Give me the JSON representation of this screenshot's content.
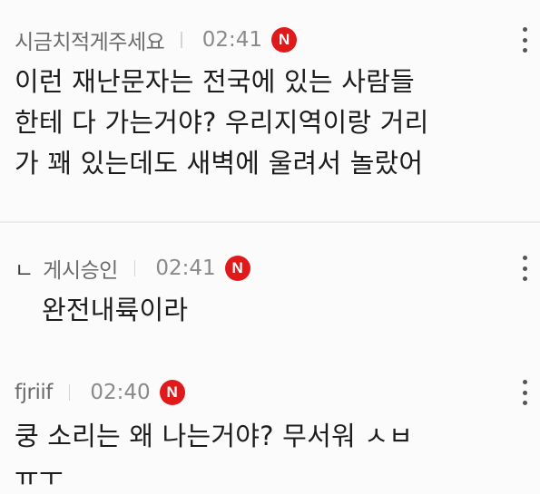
{
  "comments": [
    {
      "author": "시금치적게주세요",
      "time": "02:41",
      "badge": "N",
      "reply_marker": "",
      "body": "이런 재난문자는 전국에 있는 사람들\n한테 다 가는거야? 우리지역이랑 거리\n가 꽤 있는데도 새벽에 울려서 놀랐어"
    },
    {
      "author": "게시승인",
      "time": "02:41",
      "badge": "N",
      "reply_marker": "ㄴ",
      "body": "완전내륙이라"
    },
    {
      "author": "fjriif",
      "time": "02:40",
      "badge": "N",
      "reply_marker": "",
      "body": "쿵 소리는 왜 나는거야? 무서워 ㅅㅂ\nㅠㅜ"
    }
  ],
  "colors": {
    "background": "#fbfbfc",
    "badge": "#e0191b",
    "meta_text": "#6b6b6b",
    "divider": "#ececec"
  },
  "icons": {
    "new_badge": "new-badge-icon",
    "more": "more-vertical-icon"
  }
}
